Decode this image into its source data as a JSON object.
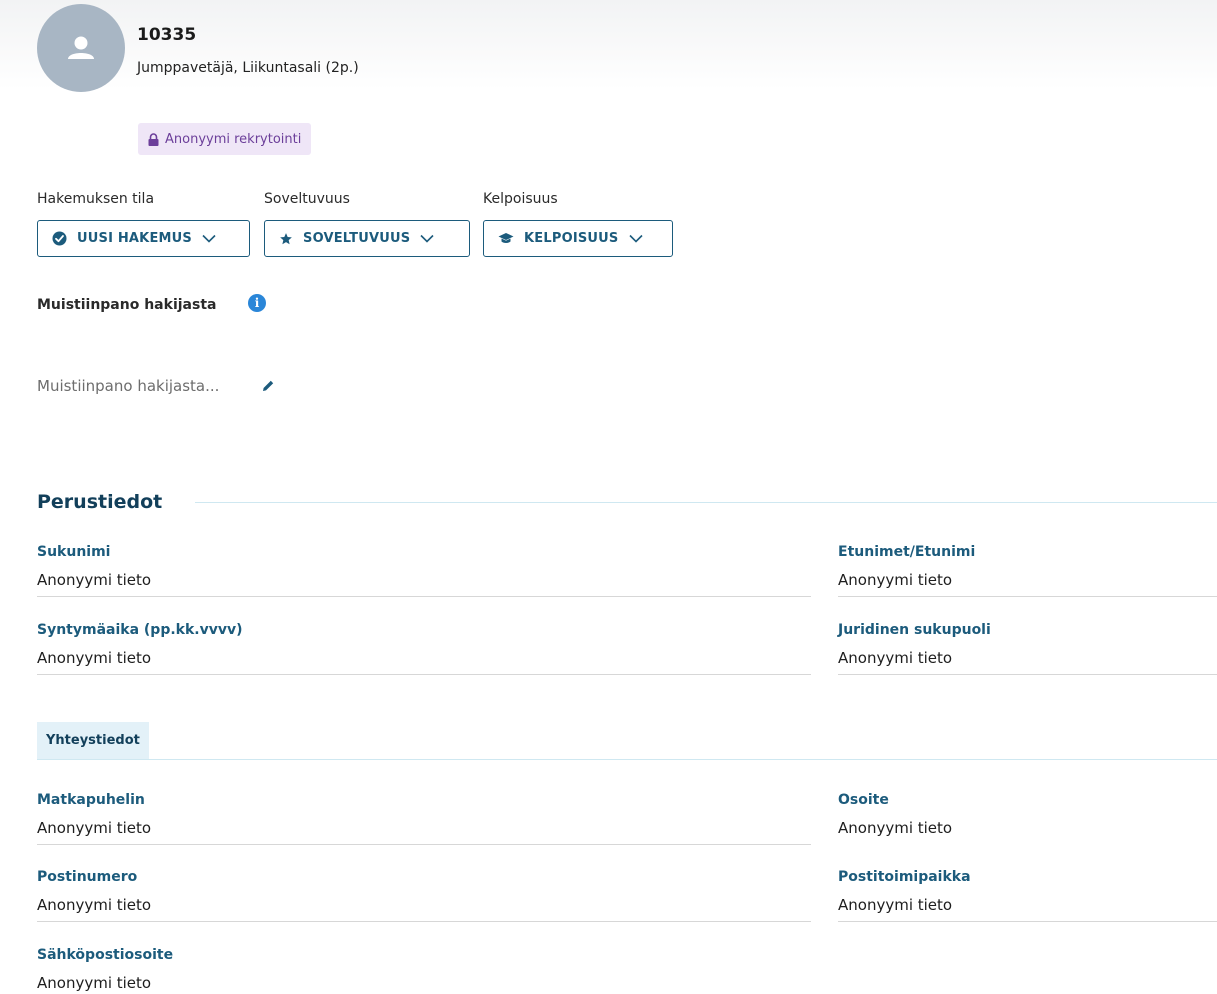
{
  "applicant": {
    "id": "10335",
    "position": "Jumppavetäjä, Liikuntasali (2p.)",
    "badge": "Anonyymi rekrytointi"
  },
  "status_fields": [
    {
      "label": "Hakemuksen tila",
      "value": "UUSI HAKEMUS",
      "icon": "check-circle-icon"
    },
    {
      "label": "Soveltuvuus",
      "value": "SOVELTUVUUS",
      "icon": "star-icon"
    },
    {
      "label": "Kelpoisuus",
      "value": "KELPOISUUS",
      "icon": "graduation-cap-icon"
    }
  ],
  "note": {
    "title": "Muistiinpano hakijasta",
    "placeholder": "Muistiinpano hakijasta..."
  },
  "basic_info": {
    "title": "Perustiedot",
    "fields": [
      {
        "label": "Sukunimi",
        "value": "Anonyymi tieto"
      },
      {
        "label": "Etunimet/Etunimi",
        "value": "Anonyymi tieto"
      },
      {
        "label": "Syntymäaika (pp.kk.vvvv)",
        "value": "Anonyymi tieto"
      },
      {
        "label": "Juridinen sukupuoli",
        "value": "Anonyymi tieto"
      }
    ]
  },
  "contact_info": {
    "title": "Yhteystiedot",
    "fields": [
      {
        "label": "Matkapuhelin",
        "value": "Anonyymi tieto"
      },
      {
        "label": "Osoite",
        "value": "Anonyymi tieto"
      },
      {
        "label": "Postinumero",
        "value": "Anonyymi tieto"
      },
      {
        "label": "Postitoimipaikka",
        "value": "Anonyymi tieto"
      },
      {
        "label": "Sähköpostiosoite",
        "value": "Anonyymi tieto"
      }
    ]
  },
  "colors": {
    "primary": "#1c5b7c",
    "heading": "#123f5a",
    "badge_bg": "#efe6f7",
    "badge_text": "#6c3f9a",
    "info": "#2a86d8"
  }
}
